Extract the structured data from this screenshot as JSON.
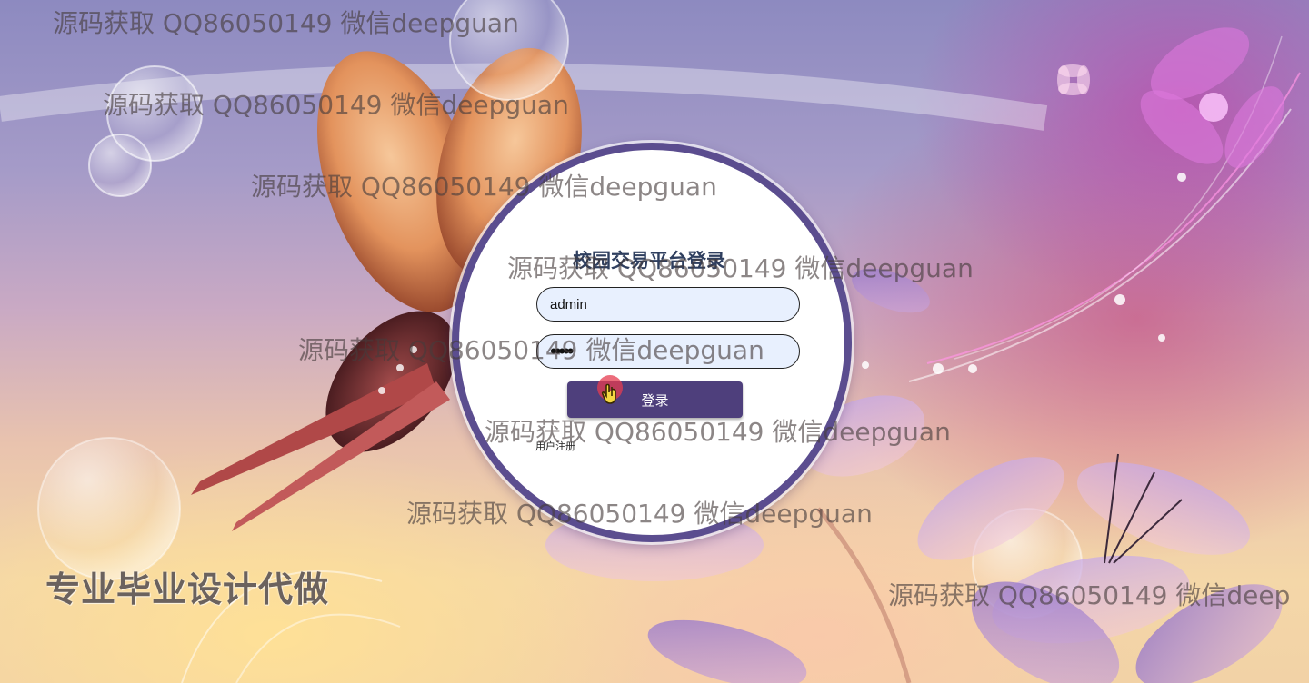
{
  "login": {
    "title": "校园交易平台登录",
    "username_value": "admin",
    "password_value": "•••••",
    "submit_label": "登录",
    "register_label": "用户注册"
  },
  "promo_text": "专业毕业设计代做",
  "watermarks": [
    "源码获取 QQ86050149 微信deepguan",
    "源码获取 QQ86050149 微信deepguan",
    "源码获取 QQ86050149 微信deepguan",
    "源码获取 QQ86050149 微信deepguan",
    "源码获取 QQ86050149 微信deepguan",
    "源码获取 QQ86050149 微信deepguan",
    "源码获取 QQ86050149 微信deepguan",
    "源码获取 QQ86050149 微信deep"
  ],
  "colors": {
    "button_bg": "#4e3f7c",
    "circle_border": "#5b4d8f",
    "input_bg": "#e8f0fe",
    "title_color": "#2f3f5f"
  },
  "cursor_icon": "hand-pointer-icon"
}
